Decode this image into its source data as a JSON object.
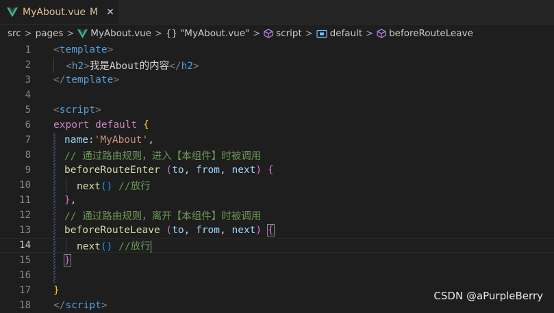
{
  "tab": {
    "filename": "MyAbout.vue",
    "modified": "M",
    "close": "✕"
  },
  "breadcrumb": {
    "src": "src",
    "pages": "pages",
    "file": "MyAbout.vue",
    "obj_icon": "{}",
    "obj": "\"MyAbout.vue\"",
    "script": "script",
    "default": "default",
    "method": "beforeRouteLeave",
    "sep": ">"
  },
  "colors": {
    "vue": "#41b883",
    "tab_text": "#e2c08d"
  },
  "lines": {
    "n1": "1",
    "n2": "2",
    "n3": "3",
    "n4": "4",
    "n5": "5",
    "n6": "6",
    "n7": "7",
    "n8": "8",
    "n9": "9",
    "n10": "10",
    "n11": "11",
    "n12": "12",
    "n13": "13",
    "n14": "14",
    "n15": "15",
    "n16": "16",
    "n17": "17",
    "n18": "18"
  },
  "code": {
    "l1_tag": "template",
    "l2_tag": "h2",
    "l2_text": "我是About的内容",
    "l2_close": "h2",
    "l3_tag": "template",
    "l5_tag": "script",
    "l6_export": "export",
    "l6_default": "default",
    "l7_key": "name",
    "l7_val": "'MyAbout'",
    "l8_comment": "// 通过路由规则，进入【本组件】时被调用",
    "l9_fn": "beforeRouteEnter",
    "l9_p1": "to",
    "l9_p2": "from",
    "l9_p3": "next",
    "l10_fn": "next",
    "l10_comment": "//放行",
    "l12_comment": "// 通过路由规则，离开【本组件】时被调用",
    "l13_fn": "beforeRouteLeave",
    "l13_p1": "to",
    "l13_p2": "from",
    "l13_p3": "next",
    "l14_fn": "next",
    "l14_comment": "//放行",
    "l18_tag": "script"
  },
  "watermark": "CSDN @aPurpleBerry"
}
